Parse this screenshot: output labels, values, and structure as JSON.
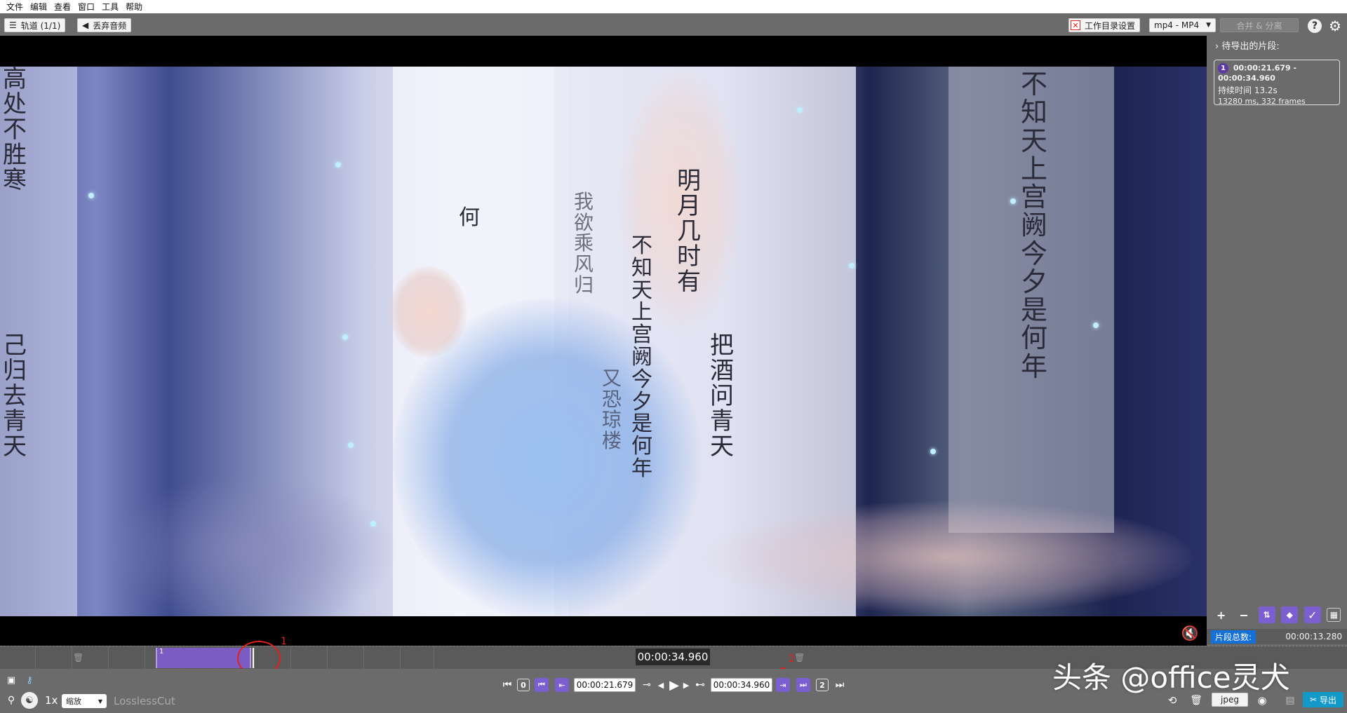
{
  "menu": [
    "文件",
    "编辑",
    "查看",
    "窗口",
    "工具",
    "帮助"
  ],
  "toolbar": {
    "tracks_label": "轨道 (1/1)",
    "discard_audio_label": "丢弃音频",
    "workdir_label": "工作目录设置",
    "format_label": "mp4 - MP4",
    "merge_label": "合并 & 分离",
    "help_symbol": "?",
    "settings_symbol": "⚙"
  },
  "sidebar": {
    "title": "待导出的片段:",
    "segment": {
      "number": "1",
      "range": "00:00:21.679 - 00:00:34.960",
      "duration": "持续时间 13.2s",
      "details": "13280 ms, 332 frames"
    },
    "total_label": "片段总数:",
    "total_value": "00:00:13.280"
  },
  "timeline": {
    "current_time": "00:00:34.960",
    "segment_number": "1",
    "annotation_1": "1",
    "annotation_2": "2"
  },
  "controls": {
    "start_time": "00:00:21.679",
    "end_time": "00:00:34.960",
    "key_0": "0",
    "key_2": "2",
    "speed": "1x",
    "zoom_label": "缩放",
    "app_name": "LosslessCut",
    "capture_format": "jpeg",
    "export_label": "导出"
  },
  "watermark": "头条 @office灵犬",
  "video_text": {
    "left_scroll": "高处不胜寒",
    "left_scroll_2": "己归去青天",
    "mid_scroll_1": "何",
    "mid_scroll_2": "我欲乘风归",
    "mid_scroll_3": "明月几时有",
    "mid_scroll_4": "不知天上宫阙今夕是何年",
    "mid_scroll_5": "把酒问青天",
    "mid_scroll_6": "又恐琼楼",
    "right_scroll": "不知天上宫阙今夕是何年"
  },
  "colors": {
    "accent_purple": "#7b5fd0",
    "export_blue": "#1299c8",
    "annotation_red": "#e0201e",
    "total_label_blue": "#1571d8"
  }
}
